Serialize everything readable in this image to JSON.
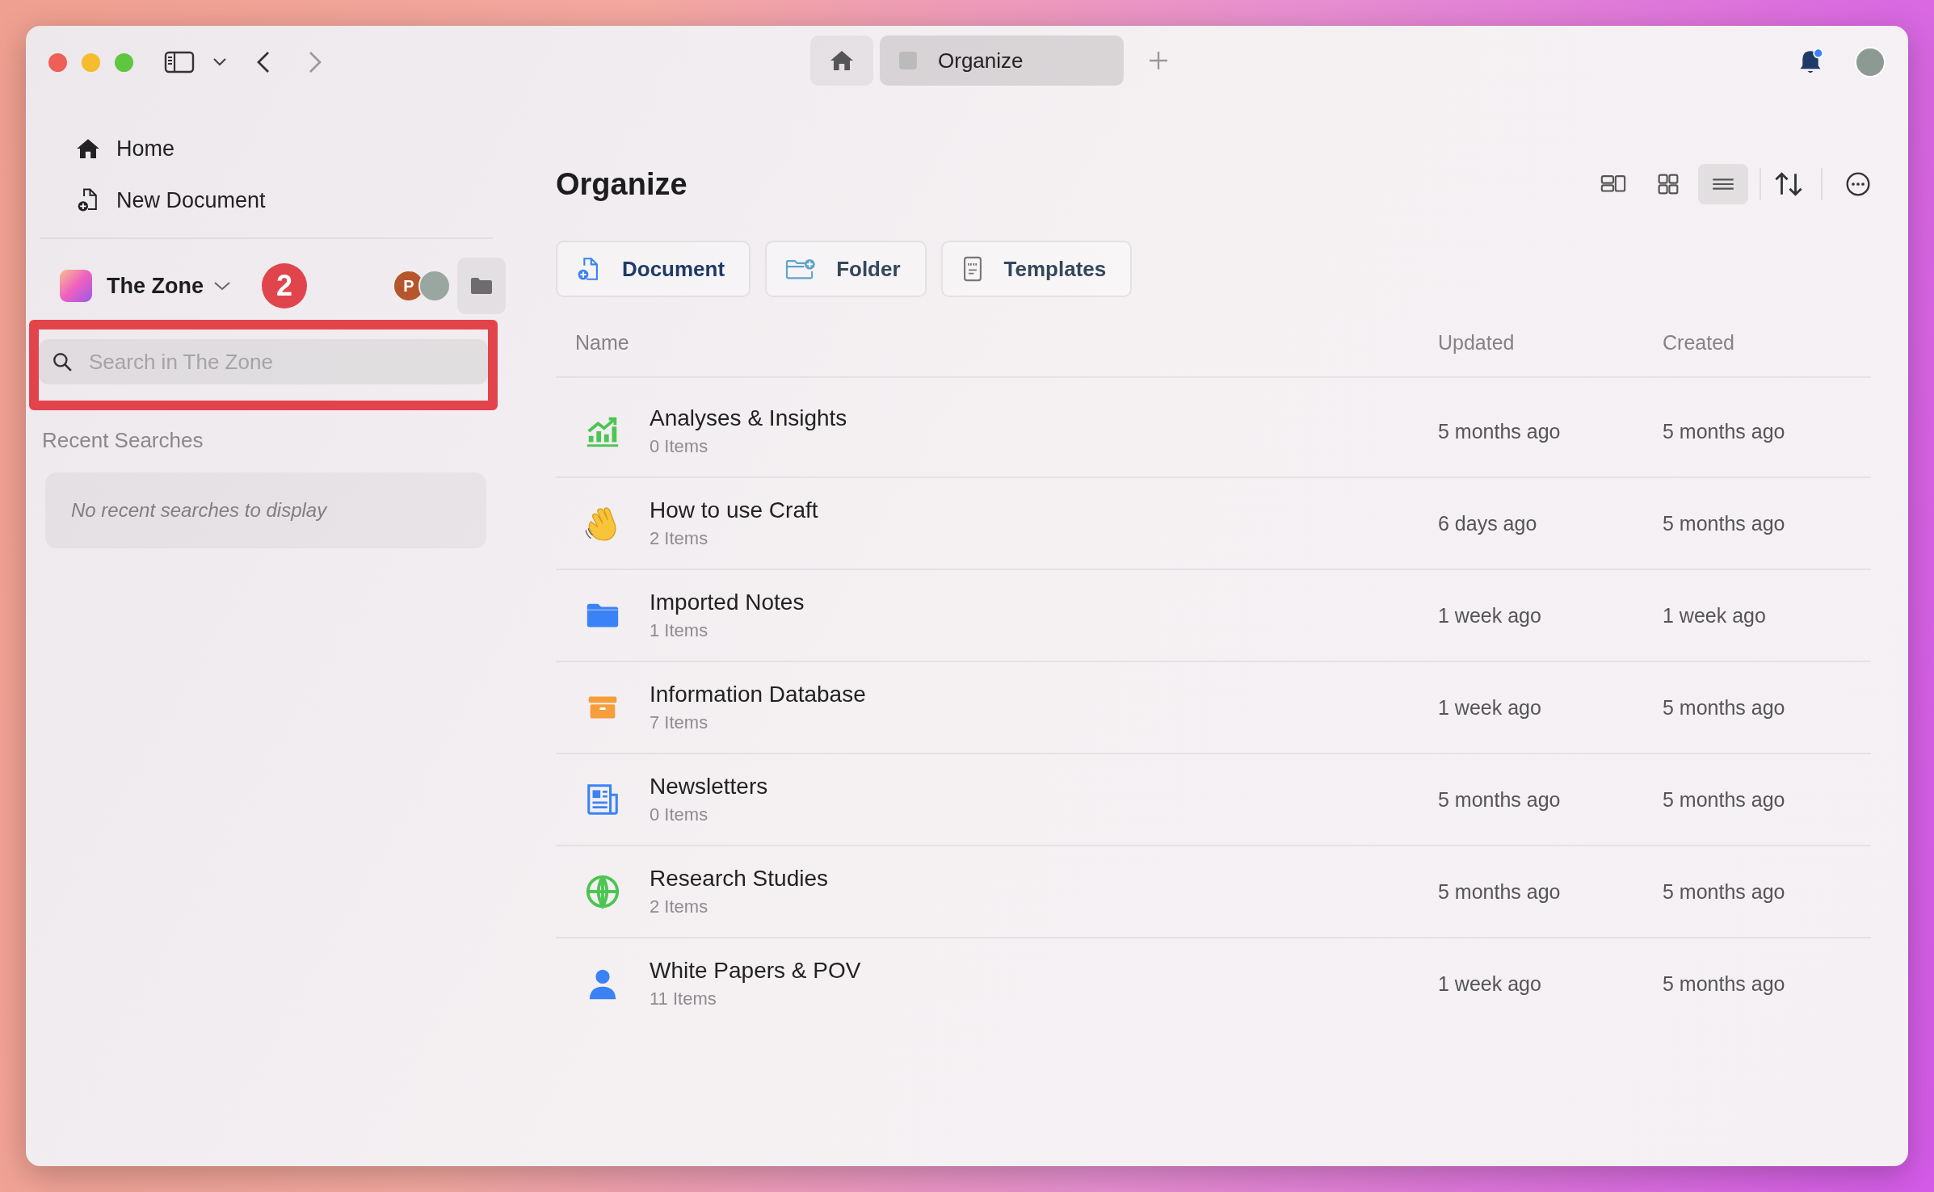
{
  "toolbar": {
    "tabs": [
      {
        "kind": "home",
        "selected": false
      },
      {
        "kind": "page",
        "label": "Organize",
        "selected": true
      }
    ]
  },
  "sidebar": {
    "items": [
      {
        "kind": "home",
        "label": "Home"
      },
      {
        "kind": "new-doc",
        "label": "New Document"
      }
    ],
    "space": {
      "name": "The Zone",
      "members": [
        {
          "initial": "P",
          "color": "#b5562c"
        },
        {
          "color": "#9aa6a0"
        }
      ]
    },
    "search": {
      "placeholder": "Search in The Zone"
    },
    "recent": {
      "title": "Recent Searches",
      "empty": "No recent searches to display"
    }
  },
  "annotation": {
    "badge": "2"
  },
  "main": {
    "title": "Organize",
    "view_modes": [
      {
        "kind": "cards",
        "selected": false
      },
      {
        "kind": "grid",
        "selected": false
      },
      {
        "kind": "list",
        "selected": true
      }
    ],
    "actions": [
      {
        "kind": "document",
        "label": "Document"
      },
      {
        "kind": "folder",
        "label": "Folder"
      },
      {
        "kind": "templates",
        "label": "Templates"
      }
    ],
    "table": {
      "columns": [
        "Name",
        "Updated",
        "Created"
      ],
      "rows": [
        {
          "kind": "chart",
          "name": "Analyses & Insights",
          "count": "0 Items",
          "updated": "5 months ago",
          "created": "5 months ago"
        },
        {
          "kind": "wave",
          "name": "How to use Craft",
          "count": "2 Items",
          "updated": "6 days ago",
          "created": "5 months ago"
        },
        {
          "kind": "folder",
          "name": "Imported Notes",
          "count": "1 Items",
          "updated": "1 week ago",
          "created": "1 week ago"
        },
        {
          "kind": "archive",
          "name": "Information Database",
          "count": "7 Items",
          "updated": "1 week ago",
          "created": "5 months ago"
        },
        {
          "kind": "news",
          "name": "Newsletters",
          "count": "0 Items",
          "updated": "5 months ago",
          "created": "5 months ago"
        },
        {
          "kind": "globe",
          "name": "Research Studies",
          "count": "2 Items",
          "updated": "5 months ago",
          "created": "5 months ago"
        },
        {
          "kind": "person",
          "name": "White Papers & POV",
          "count": "11 Items",
          "updated": "1 week ago",
          "created": "5 months ago"
        }
      ]
    }
  }
}
